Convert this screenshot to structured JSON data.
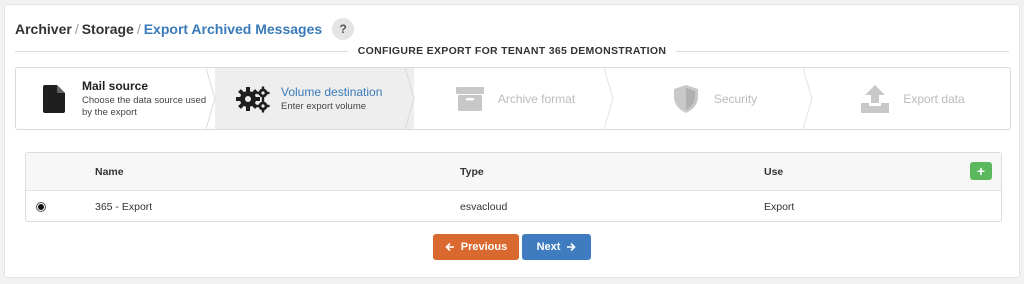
{
  "breadcrumb": {
    "items": [
      "Archiver",
      "Storage"
    ],
    "separator": "/",
    "current": "Export Archived Messages"
  },
  "help": {
    "label": "?"
  },
  "section": {
    "title": "CONFIGURE EXPORT FOR TENANT 365 DEMONSTRATION"
  },
  "steps": [
    {
      "title": "Mail source",
      "subtitle": "Choose the data source used by the export",
      "icon": "document-icon",
      "state": "done"
    },
    {
      "title": "Volume destination",
      "subtitle": "Enter export volume",
      "icon": "gears-icon",
      "state": "active"
    },
    {
      "title": "Archive format",
      "icon": "archive-box-icon",
      "state": "disabled"
    },
    {
      "title": "Security",
      "icon": "shield-icon",
      "state": "disabled"
    },
    {
      "title": "Export data",
      "icon": "upload-icon",
      "state": "disabled"
    }
  ],
  "table": {
    "columns": [
      "Name",
      "Type",
      "Use"
    ],
    "add_label": "+",
    "rows": [
      {
        "selected": true,
        "name": "365 - Export",
        "type": "esvacloud",
        "use": "Export"
      }
    ]
  },
  "buttons": {
    "previous": "Previous",
    "next": "Next"
  },
  "colors": {
    "link": "#3a7ab8",
    "previous": "#d9692f",
    "next": "#3f7bbf",
    "add": "#5cb85c",
    "active_step_bg": "#eeeeee"
  }
}
